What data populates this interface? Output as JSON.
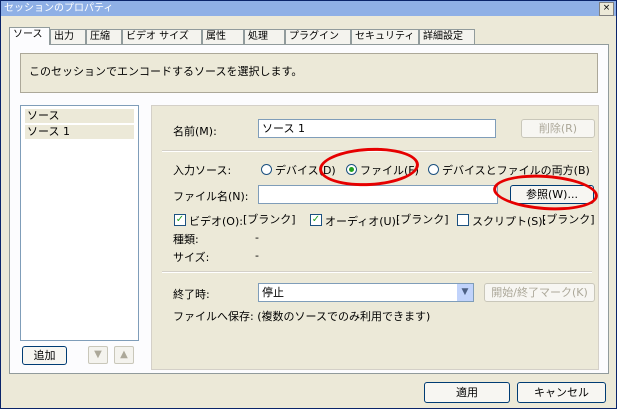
{
  "window": {
    "title": "セッションのプロパティ",
    "close_label": "×"
  },
  "tabs": [
    {
      "label": "ソース"
    },
    {
      "label": "出力"
    },
    {
      "label": "圧縮"
    },
    {
      "label": "ビデオ サイズ"
    },
    {
      "label": "属性"
    },
    {
      "label": "処理"
    },
    {
      "label": "プラグイン"
    },
    {
      "label": "セキュリティ"
    },
    {
      "label": "詳細設定"
    }
  ],
  "description": "このセッションでエンコードするソースを選択します。",
  "source_list": {
    "header": "ソース",
    "items": [
      "ソース 1"
    ]
  },
  "left_buttons": {
    "add": "追加",
    "down": "▼",
    "up": "▲"
  },
  "name": {
    "label": "名前(M):",
    "value": "ソース 1",
    "delete_label": "削除(R)"
  },
  "input_source": {
    "label": "入力ソース:",
    "options": [
      "デバイス(D)",
      "ファイル(F)",
      "デバイスとファイルの両方(B)"
    ],
    "selected": "ファイル(F)"
  },
  "file_name": {
    "label": "ファイル名(N):",
    "value": "",
    "browse_label": "参照(W)..."
  },
  "streams": {
    "video": {
      "label": "ビデオ(O):",
      "checked": true,
      "value": "[ブランク]"
    },
    "audio": {
      "label": "オーディオ(U):",
      "checked": true,
      "value": "[ブランク]"
    },
    "script": {
      "label": "スクリプト(S):",
      "checked": false,
      "value": "[ブランク]"
    }
  },
  "info": {
    "type_label": "種類:",
    "type_value": "-",
    "size_label": "サイズ:",
    "size_value": "-"
  },
  "end": {
    "label": "終了時:",
    "value": "停止",
    "marker_label": "開始/終了マーク(K)"
  },
  "save_to_file": "ファイルへ保存: (複数のソースでのみ利用できます)",
  "footer": {
    "apply": "適用",
    "cancel": "キャンセル"
  },
  "annotation_color": "#e60000"
}
